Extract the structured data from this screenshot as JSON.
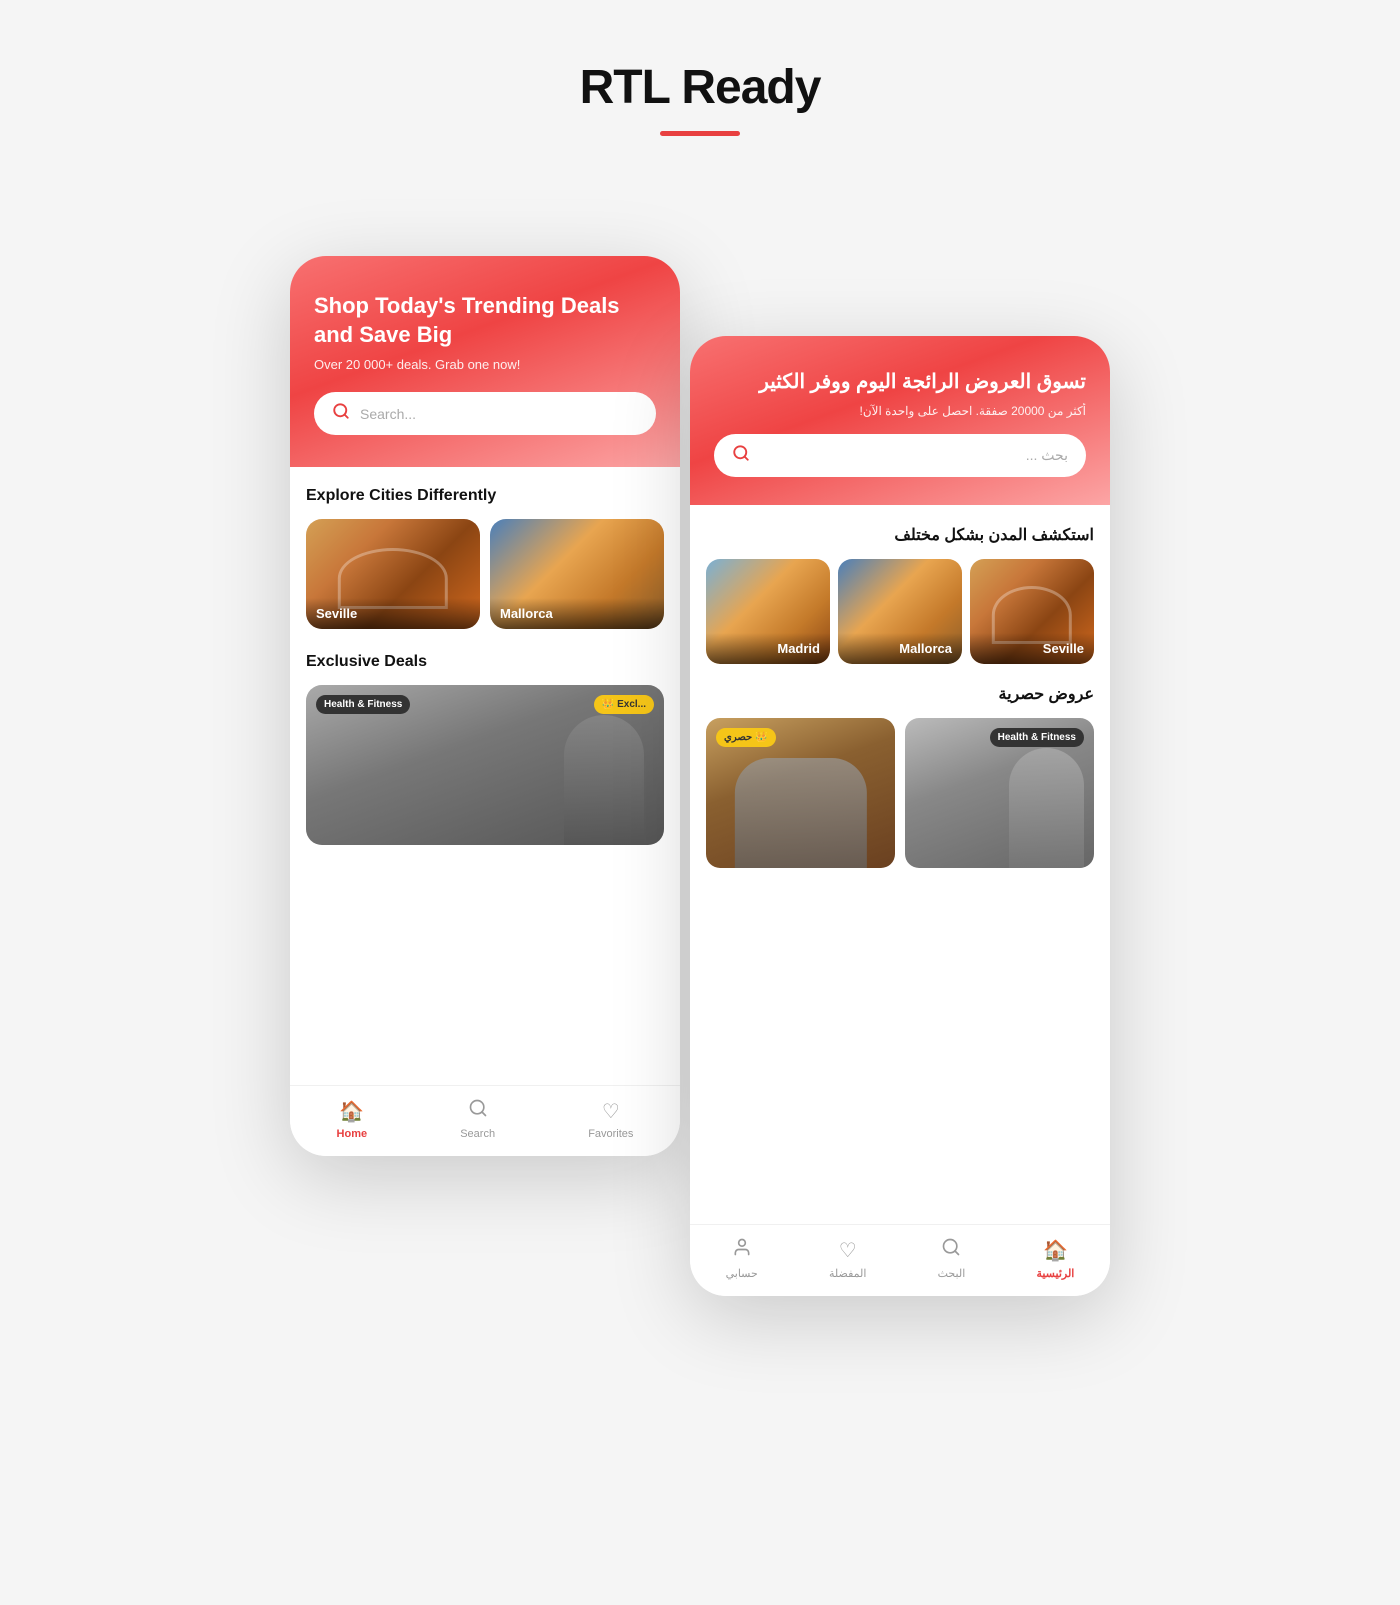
{
  "page": {
    "title": "RTL Ready",
    "accent_color": "#e84040"
  },
  "ltr_phone": {
    "header": {
      "title": "Shop Today's Trending Deals and Save Big",
      "subtitle": "Over 20 000+ deals. Grab one now!",
      "search_placeholder": "Search..."
    },
    "cities_section": {
      "title": "Explore Cities Differently",
      "cities": [
        {
          "name": "Seville",
          "type": "seville"
        },
        {
          "name": "Mallorca",
          "type": "mallorca"
        }
      ]
    },
    "deals_section": {
      "title": "Exclusive Deals",
      "deals": [
        {
          "badge": "Health & Fitness",
          "exclusive_badge": "Excl...",
          "type": "fitness"
        }
      ]
    },
    "nav": {
      "items": [
        {
          "label": "Home",
          "icon": "🏠",
          "active": true
        },
        {
          "label": "Search",
          "icon": "🔍",
          "active": false
        },
        {
          "label": "Favorites",
          "icon": "♡",
          "active": false
        }
      ]
    }
  },
  "rtl_phone": {
    "header": {
      "title": "تسوق العروض الرائجة اليوم ووفر الكثير",
      "subtitle": "أكثر من 20000 صفقة. احصل على واحدة الآن!",
      "search_placeholder": "بحث ..."
    },
    "cities_section": {
      "title": "استكشف المدن بشكل مختلف",
      "cities": [
        {
          "name": "Madrid",
          "type": "madrid"
        },
        {
          "name": "Mallorca",
          "type": "mallorca"
        },
        {
          "name": "Seville",
          "type": "seville"
        }
      ]
    },
    "deals_section": {
      "title": "عروض حصرية",
      "deals": [
        {
          "badge": "حصري",
          "exclusive": true,
          "type": "fitness_rtl1"
        },
        {
          "badge": "Health & Fitness",
          "type": "fitness_rtl2"
        }
      ]
    },
    "nav": {
      "items": [
        {
          "label": "الرئيسية",
          "icon": "🏠",
          "active": true
        },
        {
          "label": "البحث",
          "icon": "🔍",
          "active": false
        },
        {
          "label": "المفضلة",
          "icon": "♡",
          "active": false
        },
        {
          "label": "حسابي",
          "icon": "👤",
          "active": false
        }
      ]
    }
  },
  "search_label": "Search"
}
